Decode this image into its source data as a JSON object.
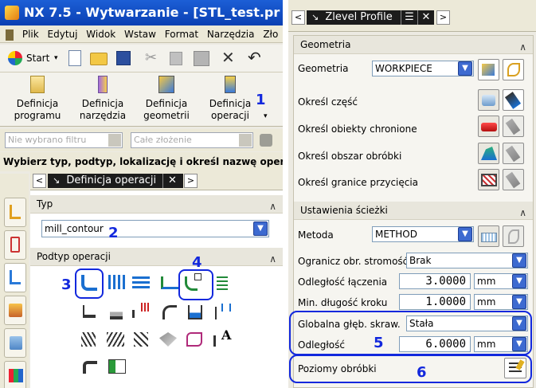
{
  "left": {
    "title": "NX 7.5 - Wytwarzanie - [STL_test.pr",
    "menu": [
      "Plik",
      "Edytuj",
      "Widok",
      "Wstaw",
      "Format",
      "Narzędzia",
      "Zło"
    ],
    "toolbar": {
      "start_label": "Start",
      "start_arrow": "▾"
    },
    "ribbon": [
      {
        "label1": "Definicja",
        "label2": "programu"
      },
      {
        "label1": "Definicja",
        "label2": "narzędzia"
      },
      {
        "label1": "Definicja",
        "label2": "geometrii"
      },
      {
        "label1": "Definicja",
        "label2": "operacji"
      }
    ],
    "ribbon_overflow": "▾",
    "filter": {
      "filter_value": "Nie wybrano filtru",
      "assembly_value": "Całe złożenie"
    },
    "prompt": "Wybierz typ, podtyp, lokalizację i określ nazwę operac",
    "dialog": {
      "title": "Definicja operacji",
      "close": "✕",
      "nav_left": "<",
      "nav_right": ">",
      "typ_section": "Typ",
      "typ_value": "mill_contour",
      "subtype_section": "Podtyp operacji",
      "collapse": "∧"
    },
    "markers": {
      "m1": "1",
      "m2": "2",
      "m3": "3",
      "m4": "4"
    }
  },
  "right": {
    "header": {
      "title": "Zlevel Profile",
      "menu": "☰",
      "close": "✕",
      "nav_left": "<",
      "nav_right": ">"
    },
    "geometry_section": "Geometria",
    "geometry_label": "Geometria",
    "geometry_value": "WORKPIECE",
    "rows": [
      "Określ część",
      "Określ obiekty chronione",
      "Określ obszar obróbki",
      "Określ granice przycięcia"
    ],
    "path_section": "Ustawienia ścieżki",
    "method_label": "Metoda",
    "method_value": "METHOD",
    "steep_label": "Ogranicz obr. stromość",
    "steep_value": "Brak",
    "merge_label": "Odległość łączenia",
    "merge_value": "3.0000",
    "merge_unit": "mm",
    "minstep_label": "Min. długość kroku",
    "minstep_value": "1.0000",
    "minstep_unit": "mm",
    "depth_label": "Globalna głęb. skraw.",
    "depth_value": "Stała",
    "distance_label": "Odległość",
    "distance_value": "6.0000",
    "distance_unit": "mm",
    "levels_label": "Poziomy obróbki",
    "collapse": "∧",
    "dd_arrow": "▼",
    "markers": {
      "m5": "5",
      "m6": "6"
    }
  },
  "colors": {
    "accent_blue": "#1228dd",
    "title_blue": "#0a3fb2",
    "panel_bg": "#eceae2"
  }
}
